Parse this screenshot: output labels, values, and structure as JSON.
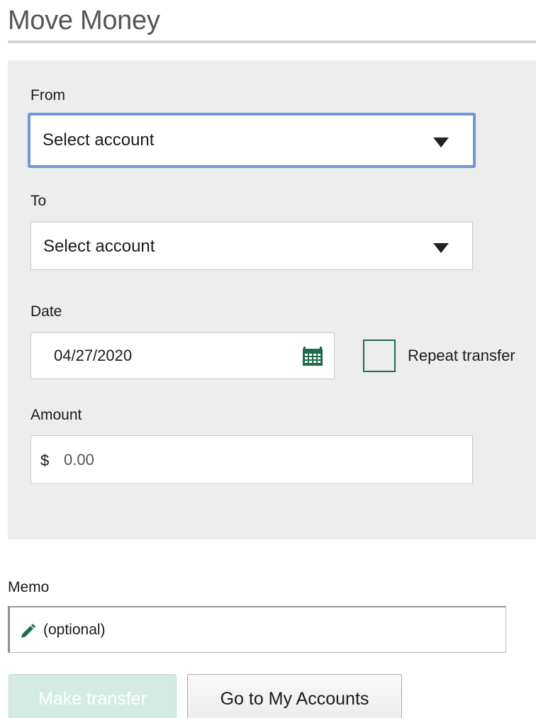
{
  "header": {
    "title": "Move Money"
  },
  "form": {
    "from": {
      "label": "From",
      "value": "Select account"
    },
    "to": {
      "label": "To",
      "value": "Select account"
    },
    "date": {
      "label": "Date",
      "value": "04/27/2020"
    },
    "repeat": {
      "label": "Repeat transfer",
      "checked": false
    },
    "amount": {
      "label": "Amount",
      "currency_symbol": "$",
      "placeholder": "0.00"
    },
    "memo": {
      "label": "Memo",
      "placeholder": "(optional)"
    }
  },
  "actions": {
    "make_transfer_label": "Make transfer",
    "go_to_accounts_label": "Go to My Accounts"
  },
  "icons": {
    "select_caret": "chevron-down-icon",
    "date_picker": "calendar-icon",
    "memo": "pencil-icon"
  },
  "colors": {
    "focus_border": "#6c9ad8",
    "brand_green": "#1f6b4a",
    "primary_disabled_bg": "#d3ebe3",
    "panel_bg": "#ededed"
  }
}
